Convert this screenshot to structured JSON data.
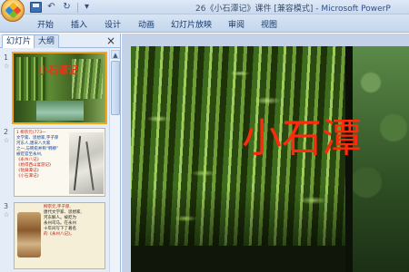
{
  "window": {
    "title_prefix": "26《小石潭记》课件 [兼容模式] - ",
    "app_name": "Microsoft PowerP"
  },
  "ribbon": {
    "tabs": [
      "开始",
      "插入",
      "设计",
      "动画",
      "幻灯片放映",
      "审阅",
      "视图"
    ]
  },
  "left_pane": {
    "tabs": [
      "幻灯片",
      "大纲"
    ],
    "close_glyph": "×",
    "slides": [
      {
        "number": "1",
        "title": "小石潭记"
      },
      {
        "number": "2",
        "lines": [
          "1 柳宗元(773一",
          "文学家、思想家,字子厚",
          "河东人,唐宋八大家",
          "之一,与韩愈并称\"韩柳\"",
          "被贬官至永州,",
          "《永州八记》",
          "《始得西山宴游记》",
          "《钴鉧潭记》",
          "《小石潭记》"
        ]
      },
      {
        "number": "3",
        "lines": [
          "柳宗元,字子厚,",
          "唐代文学家、思想家,",
          "河东解人。被贬为",
          "永州司马。在永州",
          "十年间写下了著名",
          "的《永州八记》。"
        ]
      }
    ]
  },
  "main_slide": {
    "title": "小石潭"
  },
  "colors": {
    "title_red": "#ff2a0c",
    "selected_outline": "#f4a818",
    "ribbon_blue": "#c3d6ee"
  },
  "icons": {
    "office_button": "office-logo-icon",
    "save": "save-icon",
    "undo": "undo-icon",
    "redo": "redo-icon"
  }
}
